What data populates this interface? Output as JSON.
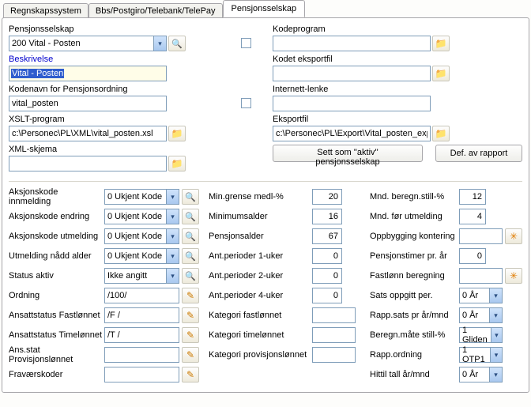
{
  "tabs": [
    "Regnskapssystem",
    "Bbs/Postgiro/Telebank/TelePay",
    "Pensjonsselskap"
  ],
  "activeTab": "Pensjonsselskap",
  "left": {
    "pensjonsselskap_label": "Pensjonsselskap",
    "pensjonsselskap_value": "200 Vital - Posten",
    "beskrivelse_label": "Beskrivelse",
    "beskrivelse_value": "Vital - Posten",
    "kodenavn_label": "Kodenavn for Pensjonsordning",
    "kodenavn_value": "vital_posten",
    "xslt_label": "XSLT-program",
    "xslt_value": "c:\\Personec\\PL\\XML\\vital_posten.xsl",
    "xmlskjema_label": "XML-skjema",
    "xmlskjema_value": ""
  },
  "right": {
    "kodeprogram_label": "Kodeprogram",
    "kodeprogram_value": "",
    "kodeteksportfil_label": "Kodet eksportfil",
    "kodeteksportfil_value": "",
    "internettlenke_label": "Internett-lenke",
    "internettlenke_value": "",
    "eksportfil_label": "Eksportfil",
    "eksportfil_value": "c:\\Personec\\PL\\Export\\Vital_posten_exp"
  },
  "buttons": {
    "set_active": "Sett som ''aktiv'' pensjonsselskap",
    "def_rapport": "Def. av rapport"
  },
  "gA": {
    "r1": {
      "l": "Aksjonskode innmelding",
      "v": "0 Ukjent Kode"
    },
    "r2": {
      "l": "Aksjonskode endring",
      "v": "0 Ukjent Kode"
    },
    "r3": {
      "l": "Aksjonskode utmelding",
      "v": "0 Ukjent Kode"
    },
    "r4": {
      "l": "Utmelding nådd alder",
      "v": "0 Ukjent Kode"
    },
    "r5": {
      "l": "Status aktiv",
      "v": "Ikke angitt"
    },
    "r6": {
      "l": "Ordning",
      "v": "/100/"
    },
    "r7": {
      "l": "Ansattstatus Fastlønnet",
      "v": "/F /"
    },
    "r8": {
      "l": "Ansattstatus Timelønnet",
      "v": "/T /"
    },
    "r9": {
      "l": "Ans.stat Provisjonslønnet",
      "v": ""
    },
    "r10": {
      "l": "Fraværskoder",
      "v": ""
    }
  },
  "gB": {
    "r1": {
      "l": "Min.grense medl-%",
      "v": "20"
    },
    "r2": {
      "l": "Minimumsalder",
      "v": "16"
    },
    "r3": {
      "l": "Pensjonsalder",
      "v": "67"
    },
    "r4": {
      "l": "Ant.perioder 1-uker",
      "v": "0"
    },
    "r5": {
      "l": "Ant.perioder 2-uker",
      "v": "0"
    },
    "r6": {
      "l": "Ant.perioder 4-uker",
      "v": "0"
    },
    "r7": {
      "l": "Kategori fastlønnet",
      "v": ""
    },
    "r8": {
      "l": "Kategori timelønnet",
      "v": ""
    },
    "r9": {
      "l": "Kategori provisjonslønnet",
      "v": ""
    }
  },
  "gC": {
    "r1": {
      "l": "Mnd. beregn.still-%",
      "v": "12"
    },
    "r2": {
      "l": "Mnd. før utmelding",
      "v": "4"
    },
    "r3": {
      "l": "Oppbygging kontering",
      "v": ""
    },
    "r4": {
      "l": "Pensjonstimer pr. år",
      "v": "0"
    },
    "r5": {
      "l": "Fastlønn beregning",
      "v": ""
    },
    "r6": {
      "l": "Sats oppgitt per.",
      "v": "0 År"
    },
    "r7": {
      "l": "Rapp.sats pr år/mnd",
      "v": "0 År"
    },
    "r8": {
      "l": "Beregn.måte still-%",
      "v": "1 Gliden"
    },
    "r9": {
      "l": "Rapp.ordning",
      "v": "1 OTP1"
    },
    "r10": {
      "l": "Hittil tall år/mnd",
      "v": "0 År"
    }
  }
}
